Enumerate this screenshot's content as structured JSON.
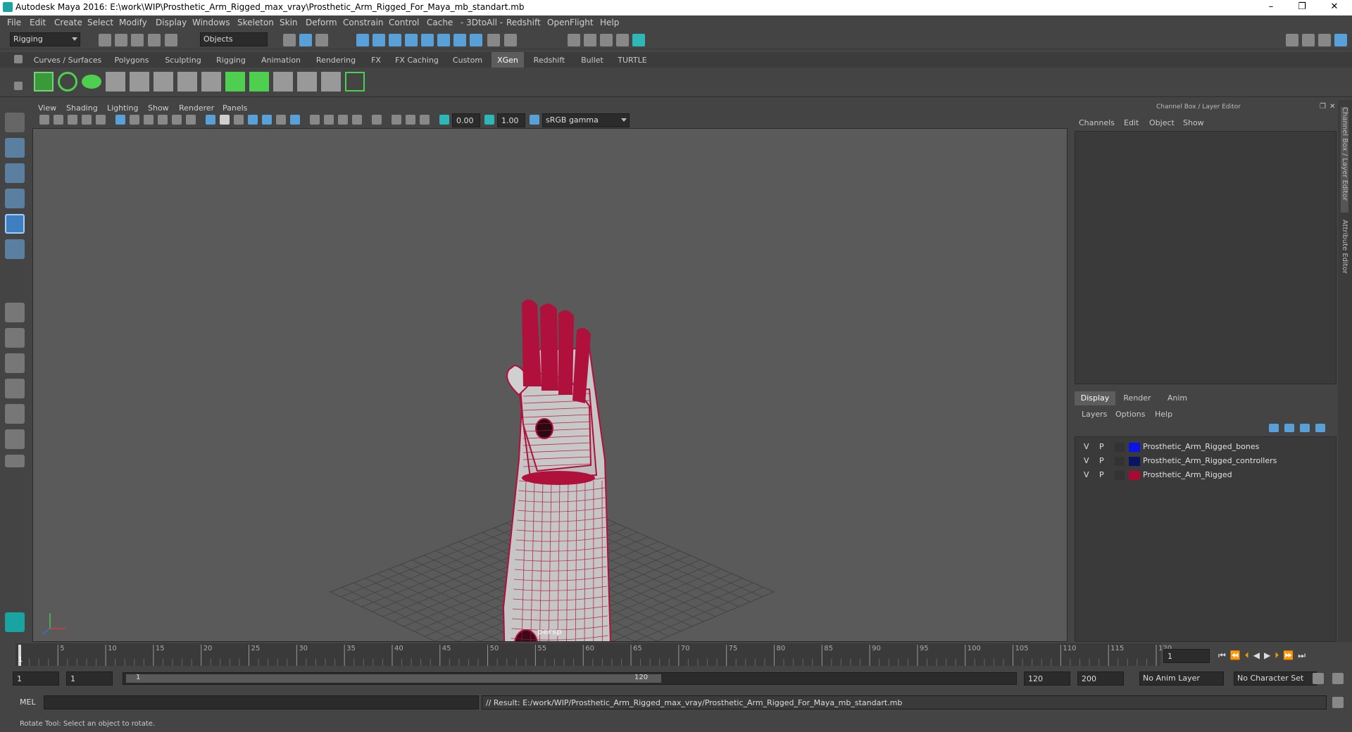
{
  "title_bar": {
    "title": "Autodesk Maya 2016: E:\\work\\WIP\\Prosthetic_Arm_Rigged_max_vray\\Prosthetic_Arm_Rigged_For_Maya_mb_standart.mb",
    "min": "–",
    "max": "❐",
    "close": "✕"
  },
  "menu": [
    "File",
    "Edit",
    "Create",
    "Select",
    "Modify",
    "Display",
    "Windows",
    "Skeleton",
    "Skin",
    "Deform",
    "Constrain",
    "Control",
    "Cache",
    "- 3DtoAll -",
    "Redshift",
    "OpenFlight",
    "Help"
  ],
  "status_line": {
    "mode": "Rigging",
    "selection_mask": "Objects"
  },
  "shelf_tabs": [
    "Curves / Surfaces",
    "Polygons",
    "Sculpting",
    "Rigging",
    "Animation",
    "Rendering",
    "FX",
    "FX Caching",
    "Custom",
    "XGen",
    "Redshift",
    "Bullet",
    "TURTLE"
  ],
  "active_shelf_tab": "XGen",
  "viewport": {
    "menu": [
      "View",
      "Shading",
      "Lighting",
      "Show",
      "Renderer",
      "Panels"
    ],
    "exposure": "0.00",
    "gamma": "1.00",
    "color_space": "sRGB gamma",
    "camera_label": "persp"
  },
  "channel_box": {
    "title": "Channel Box / Layer Editor",
    "menu": [
      "Channels",
      "Edit",
      "Object",
      "Show"
    ],
    "side_tabs": [
      "Channel Box / Layer Editor",
      "Attribute Editor"
    ]
  },
  "layer_editor": {
    "tabs": [
      "Display",
      "Render",
      "Anim"
    ],
    "active_tab": "Display",
    "menu": [
      "Layers",
      "Options",
      "Help"
    ],
    "layers": [
      {
        "v": "V",
        "p": "P",
        "name": "Prosthetic_Arm_Rigged_bones",
        "color": "#0a14e6"
      },
      {
        "v": "V",
        "p": "P",
        "name": "Prosthetic_Arm_Rigged_controllers",
        "color": "#0a1464"
      },
      {
        "v": "V",
        "p": "P",
        "name": "Prosthetic_Arm_Rigged",
        "color": "#aa0a32"
      }
    ]
  },
  "timeline": {
    "ticks": [
      "5",
      "10",
      "15",
      "20",
      "25",
      "30",
      "35",
      "40",
      "45",
      "50",
      "55",
      "60",
      "65",
      "70",
      "75",
      "80",
      "85",
      "90",
      "95",
      "100",
      "105",
      "110",
      "115",
      "120"
    ],
    "first_tick": "1",
    "current_frame": "1"
  },
  "range": {
    "start": "1",
    "anim_start": "1",
    "slider_start": "1",
    "slider_end": "120",
    "anim_end": "120",
    "end": "200",
    "anim_layer": "No Anim Layer",
    "character_set": "No Character Set"
  },
  "command_line": {
    "lang": "MEL",
    "result": "// Result: E:/work/WIP/Prosthetic_Arm_Rigged_max_vray/Prosthetic_Arm_Rigged_For_Maya_mb_standart.mb"
  },
  "help_line": "Rotate Tool: Select an object to rotate.",
  "colors": {
    "wireframe": "#b0103c",
    "mesh": "#c4c4c4",
    "grid": "#3e3e3e",
    "accent": "#1aa3a3"
  }
}
